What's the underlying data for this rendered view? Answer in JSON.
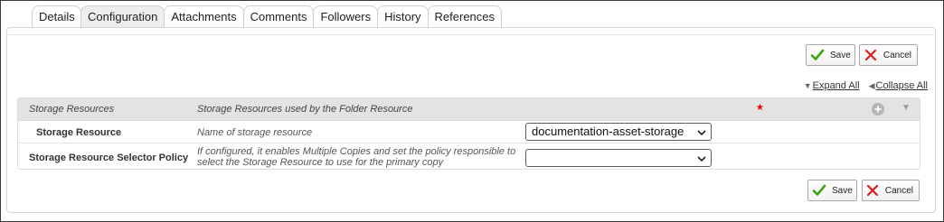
{
  "tabs": [
    {
      "label": "Details",
      "active": false
    },
    {
      "label": "Configuration",
      "active": true
    },
    {
      "label": "Attachments",
      "active": false
    },
    {
      "label": "Comments",
      "active": false
    },
    {
      "label": "Followers",
      "active": false
    },
    {
      "label": "History",
      "active": false
    },
    {
      "label": "References",
      "active": false
    }
  ],
  "buttons": {
    "save": "Save",
    "cancel": "Cancel"
  },
  "toggles": {
    "expand_all": "Expand All",
    "collapse_all": "Collapse All"
  },
  "group": {
    "name": "Storage Resources",
    "description": "Storage Resources used by the Folder Resource",
    "required_mark": "★"
  },
  "rows": [
    {
      "label": "Storage Resource",
      "description": "Name of storage resource",
      "selected": "documentation-asset-storage"
    },
    {
      "label": "Storage Resource Selector Policy",
      "description": "If configured, it enables Multiple Copies and set the policy responsible to select the Storage Resource to use for the primary copy",
      "selected": ""
    }
  ],
  "colors": {
    "save_check": "#3aa510",
    "cancel_x": "#d81f1f",
    "required": "#e00000"
  },
  "icons": {
    "save": "check-icon",
    "cancel": "x-icon",
    "add": "plus-circle-icon",
    "collapse": "triangle-down-icon"
  }
}
